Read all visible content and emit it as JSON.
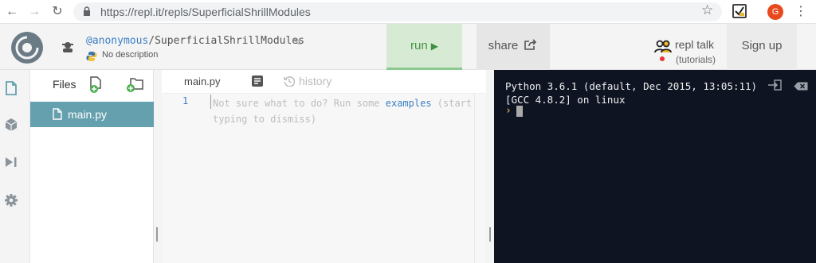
{
  "browser": {
    "url": "https://repl.it/repls/SuperficialShrillModules",
    "avatar_letter": "G"
  },
  "header": {
    "user": "@anonymous",
    "separator": "/",
    "repl_name": "SuperficialShrillModules",
    "description": "No description",
    "run_label": "run",
    "share_label": "share",
    "talk_label": "repl talk",
    "talk_sub": "(tutorials)",
    "signup_label": "Sign up"
  },
  "files": {
    "title": "Files",
    "items": [
      {
        "label": "main.py",
        "selected": true
      }
    ]
  },
  "editor": {
    "tab_label": "main.py",
    "history_label": "history",
    "line_number": "1",
    "placeholder_pre": "Not sure what to do? Run some ",
    "placeholder_link": "examples",
    "placeholder_post": " (start typing to dismiss)"
  },
  "console": {
    "line1": "Python 3.6.1 (default, Dec 2015, 13:05:11)",
    "line2": "[GCC 4.8.2] on linux",
    "prompt": "›"
  },
  "colors": {
    "accent": "#3b7fc4",
    "run_bg": "#d7ebd4",
    "run_text": "#3e9141",
    "selected_file_bg": "#64a0ad",
    "console_bg": "#0f1423",
    "prompt": "#f2c94c"
  },
  "icons": [
    "back-arrow-icon",
    "forward-arrow-icon",
    "reload-icon",
    "lock-icon",
    "star-icon",
    "extension-icon",
    "kebab-menu-icon",
    "repl-logo-icon",
    "anonymous-user-icon",
    "pencil-icon",
    "python-icon",
    "play-icon",
    "share-icon",
    "repl-talk-icon",
    "file-icon",
    "package-icon",
    "debugger-icon",
    "settings-icon",
    "add-file-icon",
    "add-folder-icon",
    "document-icon",
    "history-icon",
    "exit-console-icon",
    "clear-console-icon"
  ]
}
